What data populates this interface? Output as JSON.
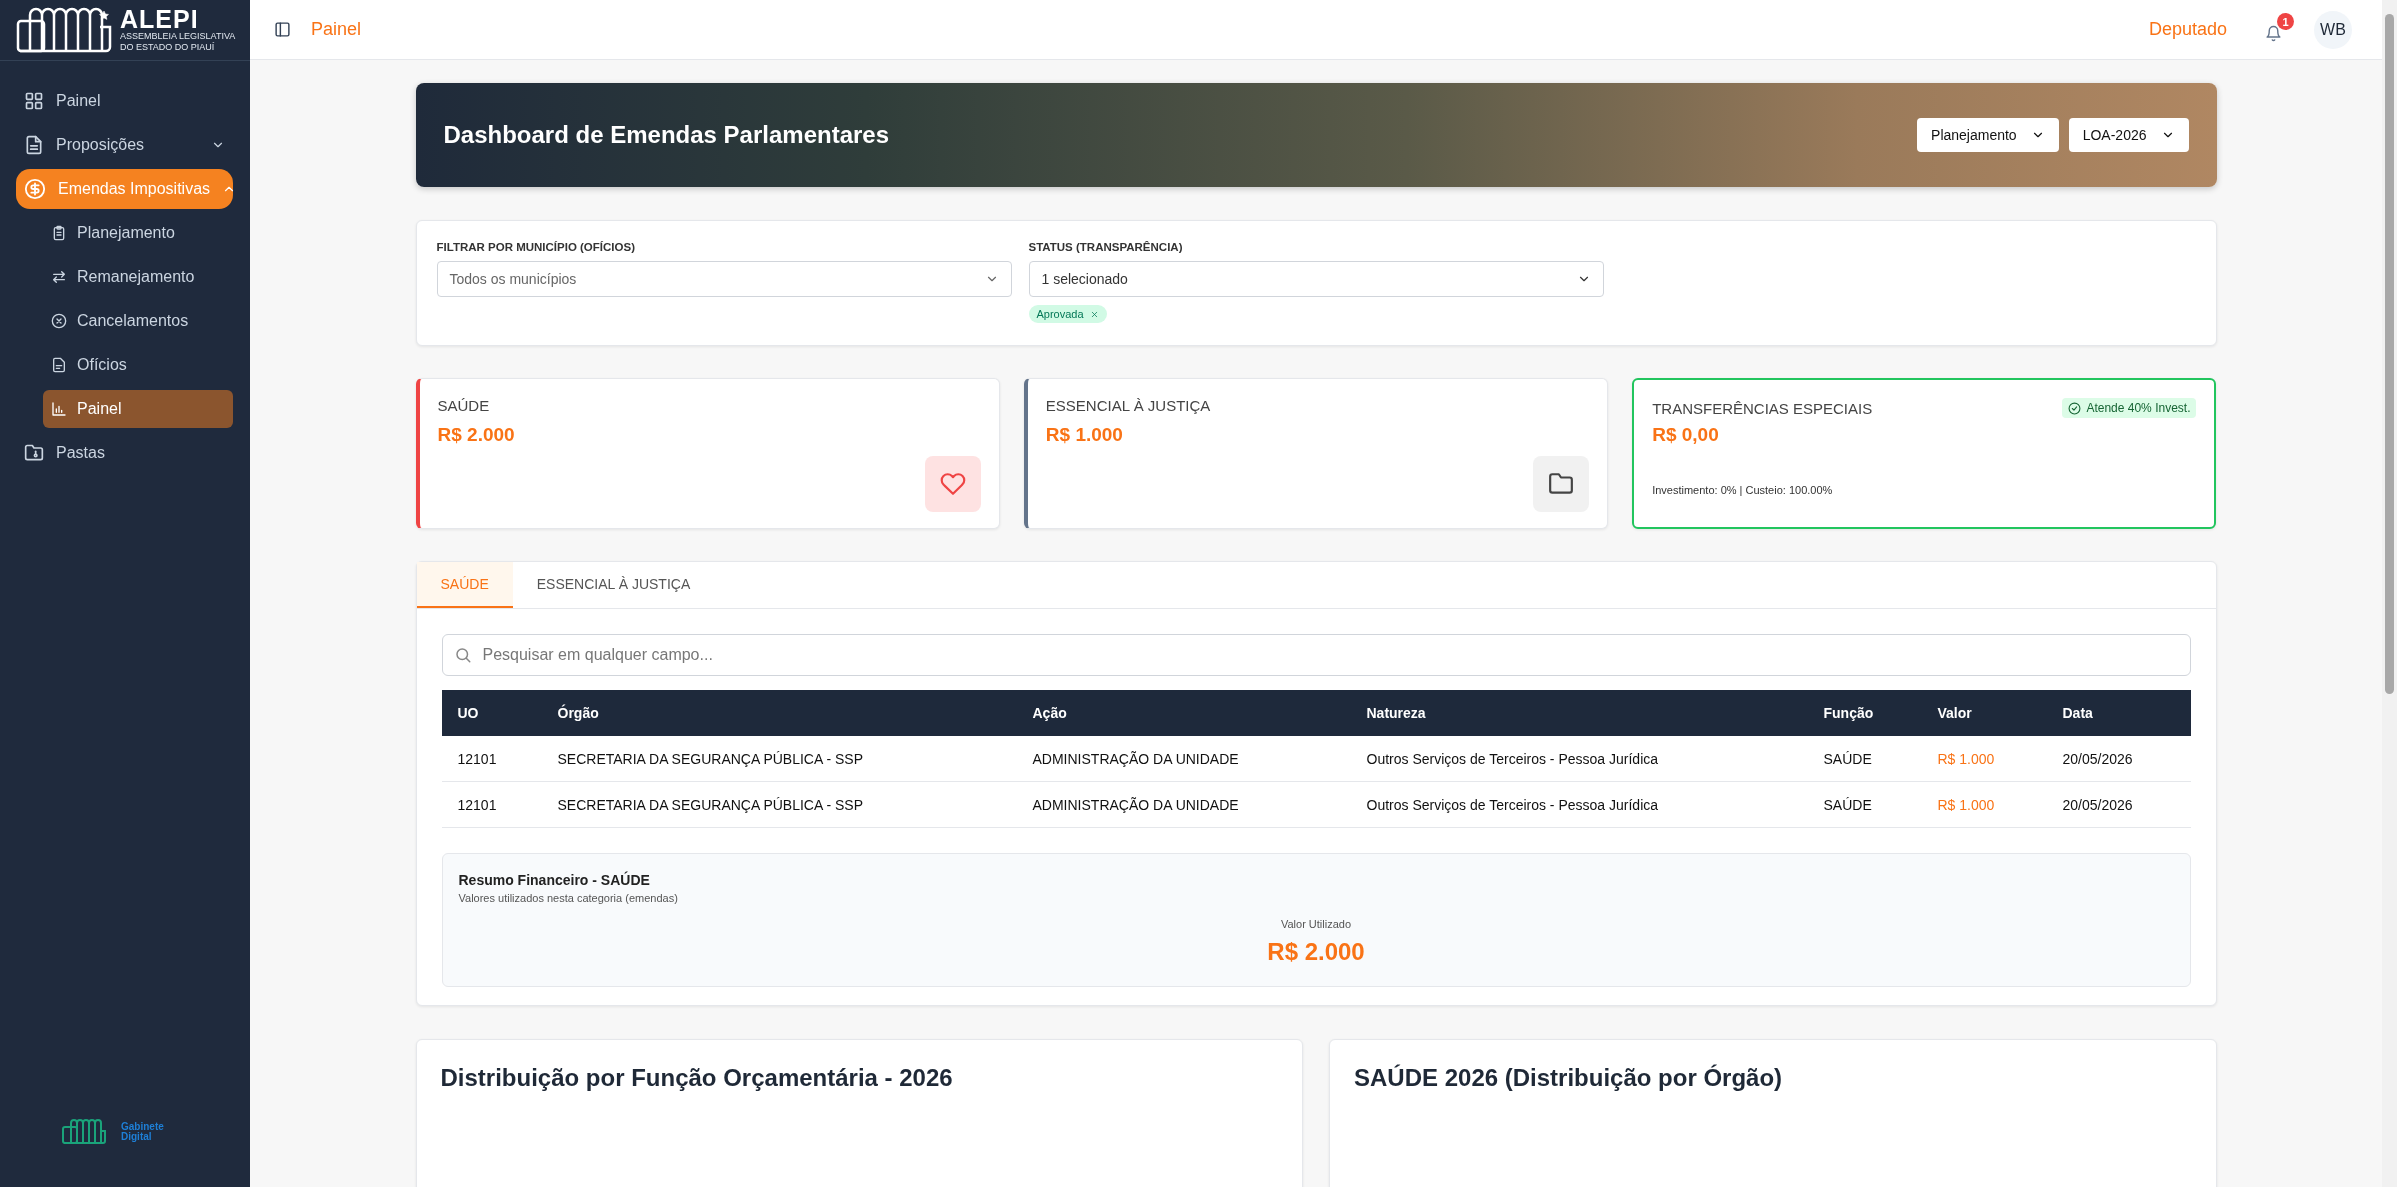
{
  "sidebar": {
    "logo": {
      "title": "ALEPI",
      "subtitle_1": "ASSEMBLEIA LEGISLATIVA",
      "subtitle_2": "DO ESTADO DO PIAUÍ"
    },
    "items": [
      {
        "label": "Painel",
        "selected": false
      },
      {
        "label": "Proposições",
        "selected": false,
        "expanded": false
      },
      {
        "label": "Emendas Impositivas",
        "selected": true,
        "expanded": true,
        "children": [
          {
            "label": "Planejamento",
            "selected": false
          },
          {
            "label": "Remanejamento",
            "selected": false
          },
          {
            "label": "Cancelamentos",
            "selected": false
          },
          {
            "label": "Ofícios",
            "selected": false
          },
          {
            "label": "Painel",
            "selected": true
          }
        ]
      },
      {
        "label": "Pastas",
        "selected": false
      }
    ],
    "footer_logo": {
      "line_1": "Gabinete",
      "line_2": "Digital"
    }
  },
  "header": {
    "breadcrumb": "Painel",
    "role": "Deputado",
    "notification_count": "1",
    "avatar_initials": "WB"
  },
  "banner": {
    "title": "Dashboard de Emendas Parlamentares",
    "selects": [
      {
        "value": "Planejamento"
      },
      {
        "value": "LOA-2026"
      }
    ]
  },
  "filters": [
    {
      "label": "FILTRAR POR MUNICÍPIO (OFÍCIOS)",
      "value": "Todos os municípios"
    },
    {
      "label": "STATUS (TRANSPARÊNCIA)",
      "value": "1 selecionado",
      "chips": [
        "Aprovada"
      ]
    }
  ],
  "summary_cards": [
    {
      "kind": "icon",
      "title": "SAÚDE",
      "amount": "R$ 2.000",
      "color": "#ef4444"
    },
    {
      "kind": "icon",
      "title": "ESSENCIAL À JUSTIÇA",
      "amount": "R$ 1.000",
      "color": "#64748b"
    },
    {
      "kind": "detail",
      "title": "TRANSFERÊNCIAS ESPECIAIS",
      "amount": "R$ 0,00",
      "color": "#22c55e",
      "badge": "Atende 40% Invest.",
      "note": "Investimento: 0% | Custeio: 100.00%"
    }
  ],
  "tabs": [
    {
      "label": "SAÚDE",
      "selected": true
    },
    {
      "label": "ESSENCIAL À JUSTIÇA",
      "selected": false
    }
  ],
  "search": {
    "placeholder": "Pesquisar em qualquer campo..."
  },
  "table": {
    "columns": [
      "UO",
      "Órgão",
      "Ação",
      "Natureza",
      "Função",
      "Valor",
      "Data"
    ],
    "rows": [
      [
        "12101",
        "SECRETARIA DA SEGURANÇA PÚBLICA - SSP",
        "ADMINISTRAÇÃO DA UNIDADE",
        "Outros Serviços de Terceiros - Pessoa Jurídica",
        "SAÚDE",
        "R$ 1.000",
        "20/05/2026"
      ],
      [
        "12101",
        "SECRETARIA DA SEGURANÇA PÚBLICA - SSP",
        "ADMINISTRAÇÃO DA UNIDADE",
        "Outros Serviços de Terceiros - Pessoa Jurídica",
        "SAÚDE",
        "R$ 1.000",
        "20/05/2026"
      ]
    ]
  },
  "financial_summary": {
    "title": "Resumo Financeiro - SAÚDE",
    "subtitle": "Valores utilizados nesta categoria (emendas)",
    "label": "Valor Utilizado",
    "value": "R$ 2.000"
  },
  "charts": [
    {
      "title": "Distribuição por Função Orçamentária - 2026"
    },
    {
      "title": "SAÚDE 2026 (Distribuição por Órgão)"
    }
  ]
}
